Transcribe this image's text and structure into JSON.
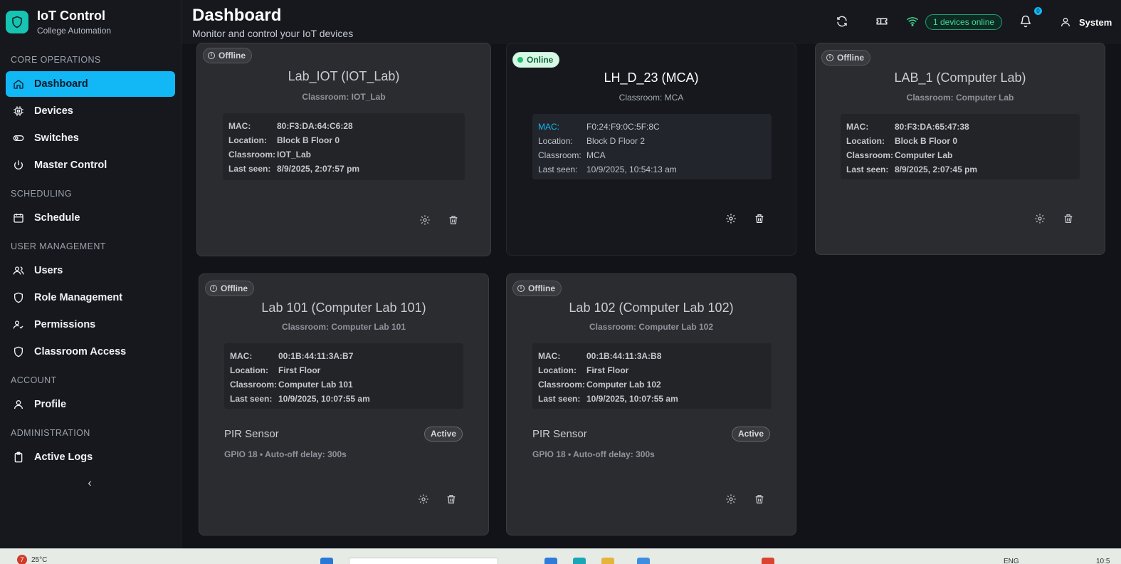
{
  "brand": {
    "title": "IoT Control",
    "subtitle": "College Automation"
  },
  "sidebar": {
    "sections": [
      {
        "label": "CORE OPERATIONS",
        "items": [
          {
            "label": "Dashboard",
            "icon": "home-icon",
            "active": true
          },
          {
            "label": "Devices",
            "icon": "cpu-icon"
          },
          {
            "label": "Switches",
            "icon": "toggle-icon"
          },
          {
            "label": "Master Control",
            "icon": "power-icon"
          }
        ]
      },
      {
        "label": "SCHEDULING",
        "items": [
          {
            "label": "Schedule",
            "icon": "calendar-icon"
          }
        ]
      },
      {
        "label": "USER MANAGEMENT",
        "items": [
          {
            "label": "Users",
            "icon": "users-icon"
          },
          {
            "label": "Role Management",
            "icon": "shield-icon"
          },
          {
            "label": "Permissions",
            "icon": "user-check-icon"
          },
          {
            "label": "Classroom Access",
            "icon": "shield-icon"
          }
        ]
      },
      {
        "label": "ACCOUNT",
        "items": [
          {
            "label": "Profile",
            "icon": "user-icon"
          }
        ]
      },
      {
        "label": "ADMINISTRATION",
        "items": [
          {
            "label": "Active Logs",
            "icon": "clipboard-icon"
          }
        ]
      }
    ],
    "collapse_glyph": "‹"
  },
  "header": {
    "title": "Dashboard",
    "subtitle": "Monitor and control your IoT devices",
    "online_pill": "1 devices online",
    "notification_count": "0",
    "user_label": "System"
  },
  "devices": [
    {
      "status": "Offline",
      "title": "Lab_IOT (IOT_Lab)",
      "classroom": "Classroom: IOT_Lab",
      "info": [
        [
          "MAC:",
          "80:F3:DA:64:C6:28"
        ],
        [
          "Location:",
          "Block B Floor 0"
        ],
        [
          "Classroom:",
          "IOT_Lab"
        ],
        [
          "Last seen:",
          "8/9/2025, 2:07:57 pm"
        ]
      ]
    },
    {
      "status": "Online",
      "title": "LH_D_23 (MCA)",
      "classroom": "Classroom: MCA",
      "info": [
        [
          "MAC:",
          "F0:24:F9:0C:5F:8C"
        ],
        [
          "Location:",
          "Block D Floor 2"
        ],
        [
          "Classroom:",
          "MCA"
        ],
        [
          "Last seen:",
          "10/9/2025, 10:54:13 am"
        ]
      ]
    },
    {
      "status": "Offline",
      "title": "LAB_1 (Computer Lab)",
      "classroom": "Classroom: Computer Lab",
      "info": [
        [
          "MAC:",
          "80:F3:DA:65:47:38"
        ],
        [
          "Location:",
          "Block B Floor 0"
        ],
        [
          "Classroom:",
          "Computer Lab"
        ],
        [
          "Last seen:",
          "8/9/2025, 2:07:45 pm"
        ]
      ]
    },
    {
      "status": "Offline",
      "title": "Lab 101 (Computer Lab 101)",
      "classroom": "Classroom: Computer Lab 101",
      "info": [
        [
          "MAC:",
          "00:1B:44:11:3A:B7"
        ],
        [
          "Location:",
          "First Floor"
        ],
        [
          "Classroom:",
          "Computer Lab 101"
        ],
        [
          "Last seen:",
          "10/9/2025, 10:07:55 am"
        ]
      ],
      "sensor": {
        "name": "PIR Sensor",
        "state": "Active",
        "meta": "GPIO 18 • Auto-off delay: 300s"
      }
    },
    {
      "status": "Offline",
      "title": "Lab 102 (Computer Lab 102)",
      "classroom": "Classroom: Computer Lab 102",
      "info": [
        [
          "MAC:",
          "00:1B:44:11:3A:B8"
        ],
        [
          "Location:",
          "First Floor"
        ],
        [
          "Classroom:",
          "Computer Lab 102"
        ],
        [
          "Last seen:",
          "10/9/2025, 10:07:55 am"
        ]
      ],
      "sensor": {
        "name": "PIR Sensor",
        "state": "Active",
        "meta": "GPIO 18 • Auto-off delay: 300s"
      }
    }
  ],
  "taskbar": {
    "weather_badge": "7",
    "weather": "25°C",
    "lang": "ENG",
    "clock": "10:5"
  },
  "colors": {
    "accent": "#11b8f5",
    "online": "#21c16b",
    "brand": "#17c3b2"
  }
}
